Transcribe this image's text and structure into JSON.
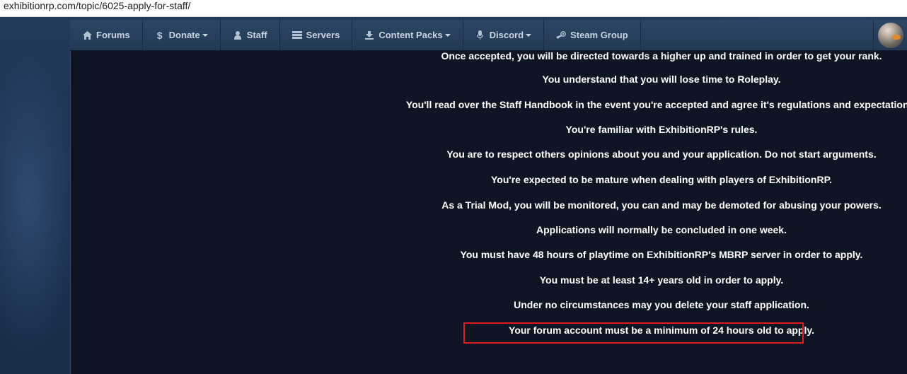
{
  "browser": {
    "url": "exhibitionrp.com/topic/6025-apply-for-staff/"
  },
  "navbar": {
    "items": [
      {
        "label": "Forums",
        "icon": "home-icon",
        "dropdown": false
      },
      {
        "label": "Donate",
        "icon": "dollar-icon",
        "dropdown": true
      },
      {
        "label": "Staff",
        "icon": "user-icon",
        "dropdown": false
      },
      {
        "label": "Servers",
        "icon": "server-icon",
        "dropdown": false
      },
      {
        "label": "Content Packs",
        "icon": "download-icon",
        "dropdown": true
      },
      {
        "label": "Discord",
        "icon": "microphone-icon",
        "dropdown": true
      },
      {
        "label": "Steam Group",
        "icon": "steam-icon",
        "dropdown": false
      }
    ],
    "avatar": "user-avatar"
  },
  "content": {
    "rules": [
      "Once accepted, you will be directed towards a higher up and trained in order to get your rank.",
      "You understand that you will lose time to Roleplay.",
      "You'll read over the Staff Handbook in the event you're accepted and agree it's regulations and expectations.",
      "You're familiar with ExhibitionRP's rules.",
      "You are to respect others opinions about you and your application. Do not start arguments.",
      "You're expected to be mature when dealing with players of ExhibitionRP.",
      "As a Trial Mod, you will be monitored, you can and may be demoted for abusing your powers.",
      "Applications will normally be concluded in one week.",
      "You must have 48 hours of playtime on ExhibitionRP's MBRP server in order to apply.",
      "You must be at least 14+ years old in order to apply.",
      "Under no circumstances may you delete your staff application.",
      "Your forum account must be a minimum of 24 hours old to apply."
    ],
    "highlighted_rule_index": 11
  },
  "colors": {
    "nav_background": "#2c4665",
    "content_background": "#0f1623",
    "text": "#ffffff",
    "highlight": "#e01c1c"
  }
}
